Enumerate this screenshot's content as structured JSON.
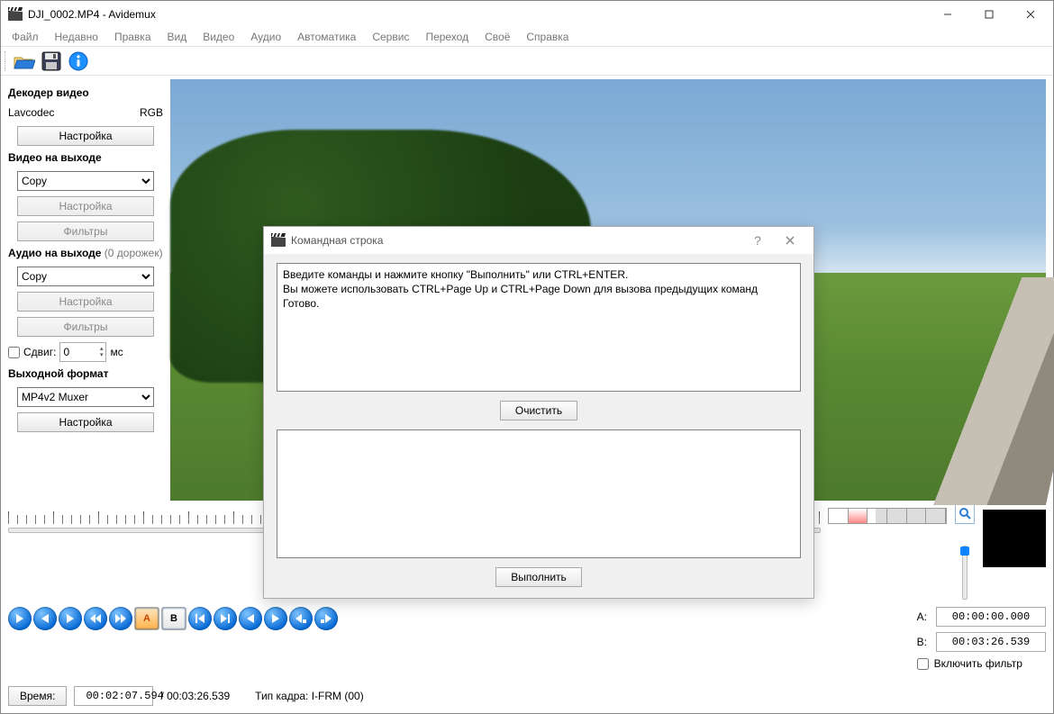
{
  "title": "DJI_0002.MP4 - Avidemux",
  "menu": [
    "Файл",
    "Недавно",
    "Правка",
    "Вид",
    "Видео",
    "Аудио",
    "Автоматика",
    "Сервис",
    "Переход",
    "Своё",
    "Справка"
  ],
  "sidebar": {
    "decoder_hdr": "Декодер видео",
    "decoder_name": "Lavcodec",
    "decoder_mode": "RGB",
    "btn_configure": "Настройка",
    "video_out_hdr": "Видео на выходе",
    "video_out_sel": "Copy",
    "btn_filters": "Фильтры",
    "audio_out_hdr": "Аудио на выходе",
    "audio_tracks": "(0 дорожек)",
    "audio_out_sel": "Copy",
    "shift_label": "Сдвиг:",
    "shift_value": "0",
    "shift_unit": "мс",
    "format_hdr": "Выходной формат",
    "format_sel": "MP4v2 Muxer"
  },
  "dialog": {
    "title": "Командная строка",
    "text": "Введите команды и нажмите кнопку \"Выполнить\" или CTRL+ENTER.\nВы можете использовать CTRL+Page Up и CTRL+Page Down для вызова предыдущих команд\nГотово.",
    "btn_clear": "Очистить",
    "btn_run": "Выполнить"
  },
  "markers": {
    "a_label": "A:",
    "a_value": "00:00:00.000",
    "b_label": "B:",
    "b_value": "00:03:26.539",
    "filter_chk": "Включить фильтр"
  },
  "status": {
    "time_label": "Время:",
    "time_value": "00:02:07.594",
    "total": "/ 00:03:26.539",
    "frame_type": "Тип кадра:  I-FRM (00)"
  },
  "timeline": {
    "thumb_pct": 61
  }
}
